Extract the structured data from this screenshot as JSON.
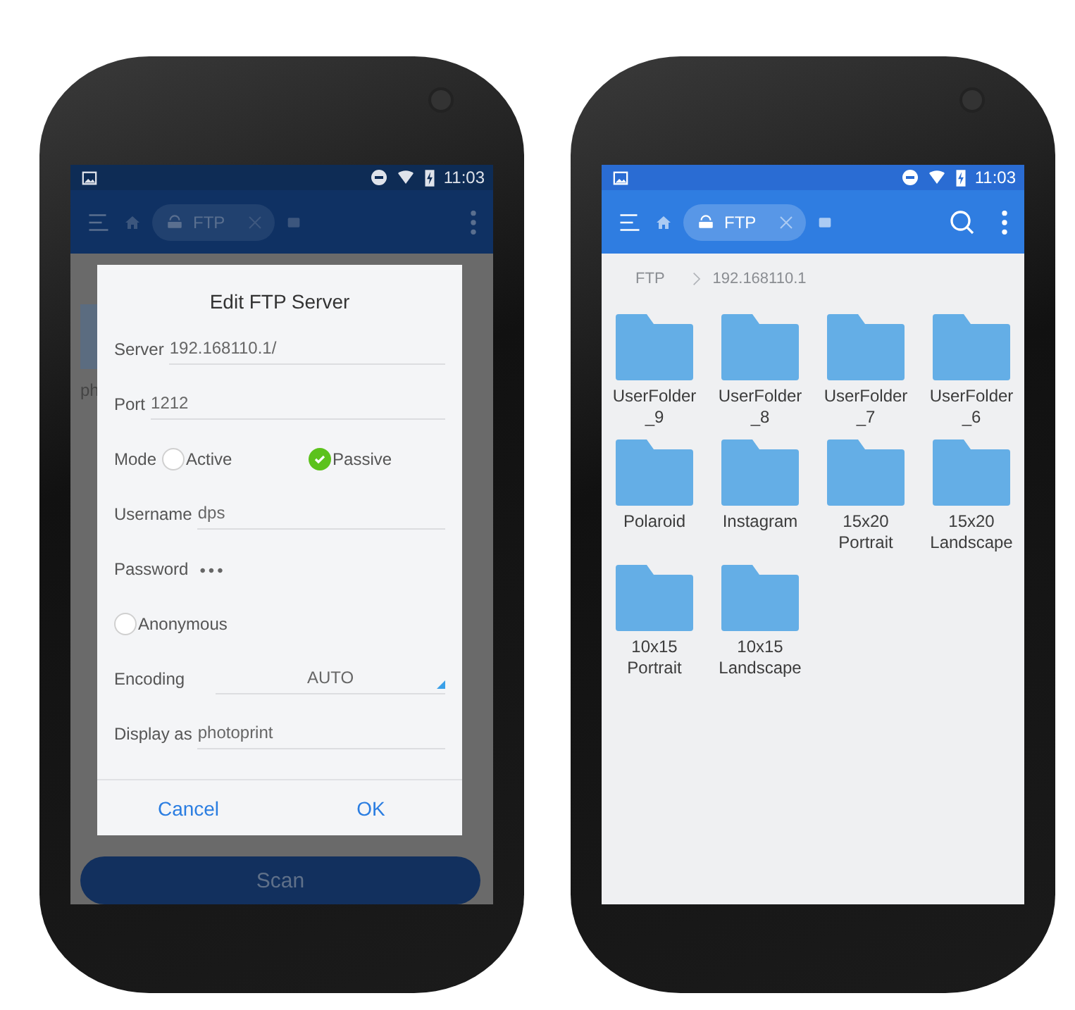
{
  "left_phone": {
    "status_bar": {
      "time": "11:03"
    },
    "app_bar": {
      "tab_label": "FTP"
    },
    "background_item": {
      "label": "ph"
    },
    "dialog": {
      "title": "Edit FTP Server",
      "fields": [
        {
          "kind": "text",
          "label": "Server",
          "value": "192.168110.1/"
        },
        {
          "kind": "text",
          "label": "Port",
          "value": "1212"
        },
        {
          "kind": "radio",
          "label": "Mode",
          "options": [
            {
              "label": "Active",
              "selected": false
            },
            {
              "label": "Passive",
              "selected": true
            }
          ]
        },
        {
          "kind": "text",
          "label": "Username",
          "value": "dps"
        },
        {
          "kind": "password",
          "label": "Password",
          "value": "•••"
        },
        {
          "kind": "checkbox",
          "label": "Anonymous",
          "checked": false
        },
        {
          "kind": "select",
          "label": "Encoding",
          "value": "AUTO"
        },
        {
          "kind": "text",
          "label": "Display as",
          "value": "photoprint"
        }
      ],
      "buttons": [
        "Cancel",
        "OK"
      ]
    },
    "scan_button": "Scan"
  },
  "right_phone": {
    "status_bar": {
      "time": "11:03"
    },
    "app_bar": {
      "tab_label": "FTP"
    },
    "breadcrumb": [
      "FTP",
      "192.168110.1"
    ],
    "folders": [
      {
        "label": "UserFolder_9"
      },
      {
        "label": "UserFolder_8"
      },
      {
        "label": "UserFolder_7"
      },
      {
        "label": "UserFolder_6"
      },
      {
        "label": "Polaroid"
      },
      {
        "label": "Instagram"
      },
      {
        "label": "15x20 Portrait"
      },
      {
        "label": "15x20 Landscape"
      },
      {
        "label": "10x15 Portrait"
      },
      {
        "label": "10x15 Landscape"
      }
    ]
  }
}
